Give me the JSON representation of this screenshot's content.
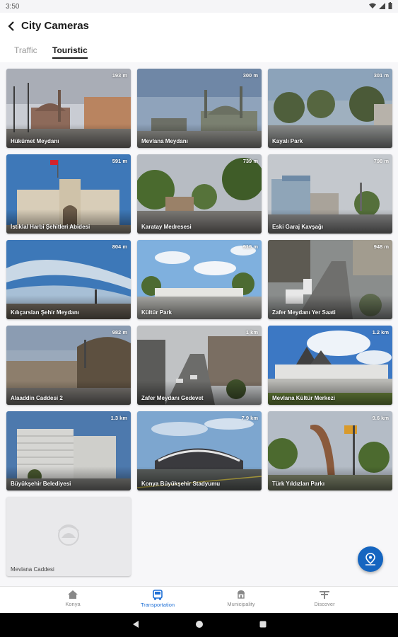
{
  "status": {
    "time": "3:50"
  },
  "header": {
    "title": "City Cameras"
  },
  "tabs": [
    {
      "label": "Traffic",
      "active": false
    },
    {
      "label": "Touristic",
      "active": true
    }
  ],
  "cameras": [
    {
      "name": "Hükümet Meydanı",
      "distance": "193 m"
    },
    {
      "name": "Mevlana Meydanı",
      "distance": "300 m"
    },
    {
      "name": "Kayalı Park",
      "distance": "301 m"
    },
    {
      "name": "İstiklal Harbi Şehitleri Abidesi",
      "distance": "591 m"
    },
    {
      "name": "Karatay Medresesi",
      "distance": "739 m"
    },
    {
      "name": "Eski Garaj Kavşağı",
      "distance": "798 m"
    },
    {
      "name": "Kılıçarslan Şehir Meydanı",
      "distance": "804 m"
    },
    {
      "name": "Kültür Park",
      "distance": "919 m"
    },
    {
      "name": "Zafer Meydanı Yer Saati",
      "distance": "948 m"
    },
    {
      "name": "Alaaddin Caddesi 2",
      "distance": "982 m"
    },
    {
      "name": "Zafer Meydanı Gedevet",
      "distance": "1 km"
    },
    {
      "name": "Mevlana Kültür Merkezi",
      "distance": "1.2 km"
    },
    {
      "name": "Büyükşehir Belediyesi",
      "distance": "1.3 km"
    },
    {
      "name": "Konya Büyükşehir Stadyumu",
      "distance": "7.9 km"
    },
    {
      "name": "Türk Yıldızları Parkı",
      "distance": "9.6 km"
    },
    {
      "name": "Mevlana Caddesi",
      "distance": ""
    }
  ],
  "bottom_nav": [
    {
      "label": "Konya",
      "icon": "home-icon",
      "active": false
    },
    {
      "label": "Transportation",
      "icon": "bus-icon",
      "active": true
    },
    {
      "label": "Municipality",
      "icon": "municipality-icon",
      "active": false
    },
    {
      "label": "Discover",
      "icon": "discover-icon",
      "active": false
    }
  ],
  "colors": {
    "accent": "#1565c0",
    "nav_active": "#1e6fd6"
  }
}
